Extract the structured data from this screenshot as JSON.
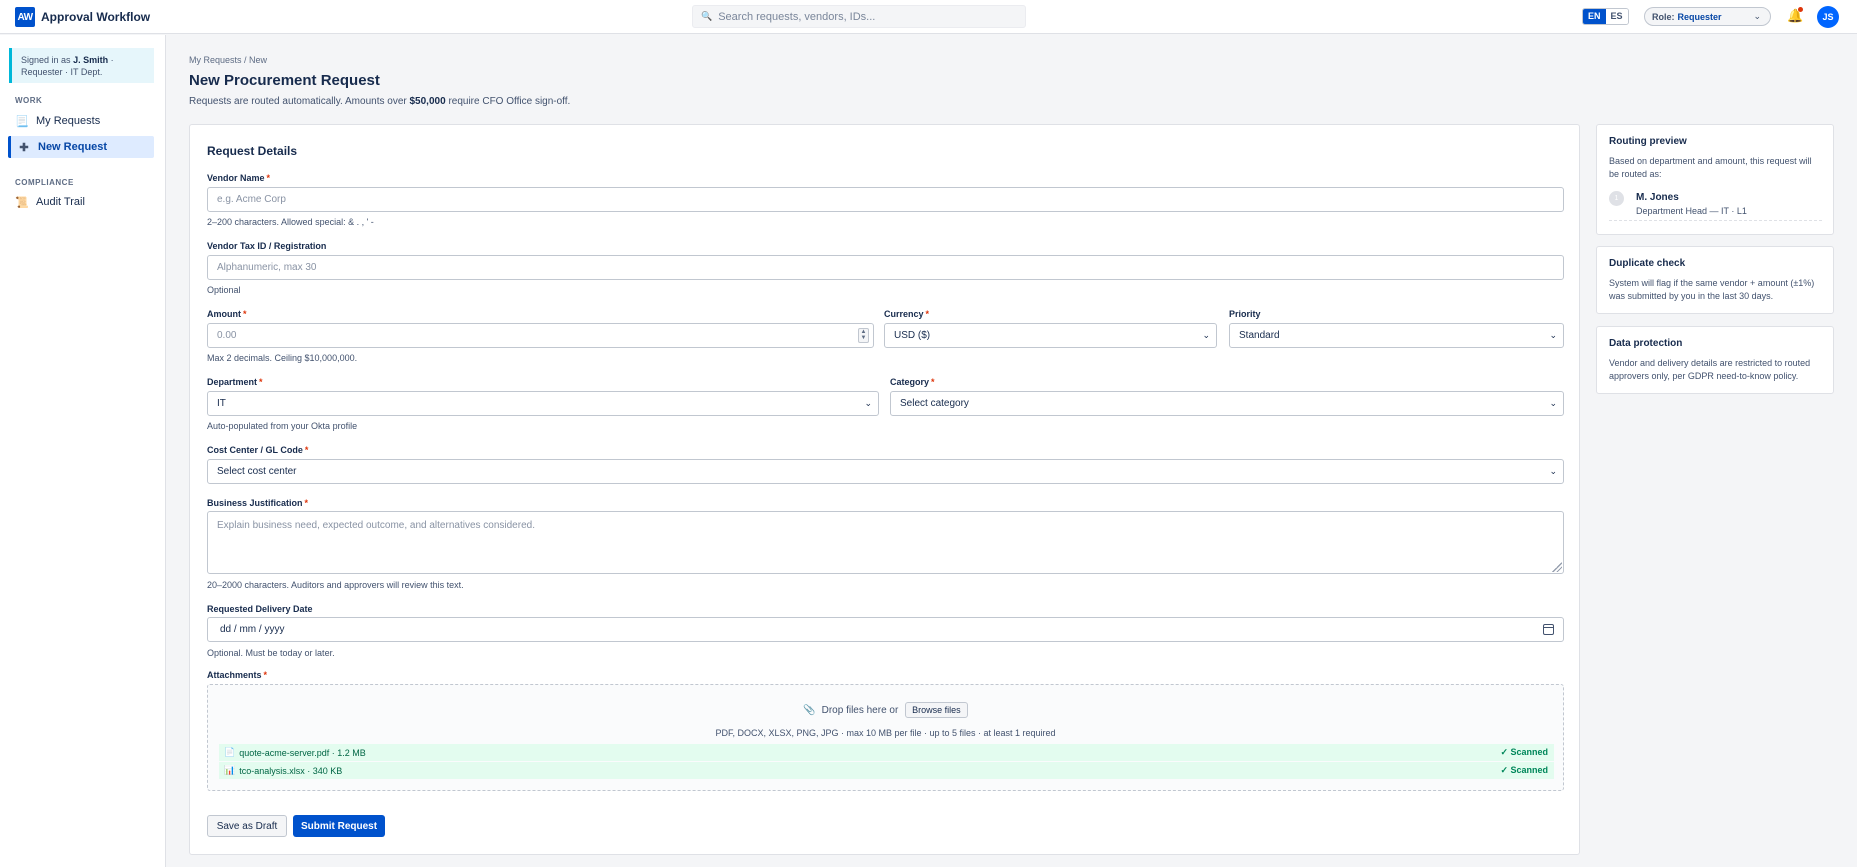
{
  "header": {
    "logo": "AW",
    "app_title": "Approval Workflow",
    "search_placeholder": "Search requests, vendors, IDs...",
    "languages": [
      "EN",
      "ES"
    ],
    "active_language": "EN",
    "role_label": "Role:",
    "role_value": "Requester",
    "avatar_initials": "JS"
  },
  "sidebar": {
    "signed_prefix": "Signed in as",
    "signed_name": "J. Smith",
    "signed_suffix": "·",
    "signed_role": "Requester · IT Dept.",
    "sections": [
      {
        "label": "WORK",
        "items": [
          {
            "label": "My Requests",
            "icon": "document-icon",
            "active": false
          },
          {
            "label": "New Request",
            "icon": "plus-icon",
            "active": true
          }
        ]
      },
      {
        "label": "COMPLIANCE",
        "items": [
          {
            "label": "Audit Trail",
            "icon": "scroll-icon",
            "active": false
          }
        ]
      }
    ]
  },
  "page": {
    "breadcrumb": "My Requests / New",
    "title": "New Procurement Request",
    "subtitle_pre": "Requests are routed automatically. Amounts over",
    "subtitle_amount": "$50,000",
    "subtitle_post": "require CFO Office sign-off."
  },
  "form": {
    "section_title": "Request Details",
    "vendor_name": {
      "label": "Vendor Name",
      "placeholder": "e.g. Acme Corp",
      "help": "2–200 characters. Allowed special: & . , ' -"
    },
    "vendor_tax": {
      "label": "Vendor Tax ID / Registration",
      "placeholder": "Alphanumeric, max 30",
      "help": "Optional"
    },
    "amount": {
      "label": "Amount",
      "placeholder": "0.00",
      "help": "Max 2 decimals. Ceiling $10,000,000."
    },
    "currency": {
      "label": "Currency",
      "value": "USD ($)"
    },
    "priority": {
      "label": "Priority",
      "value": "Standard"
    },
    "department": {
      "label": "Department",
      "value": "IT",
      "help": "Auto-populated from your Okta profile"
    },
    "category": {
      "label": "Category",
      "value": "Select category"
    },
    "cost_center": {
      "label": "Cost Center / GL Code",
      "value": "Select cost center"
    },
    "justification": {
      "label": "Business Justification",
      "placeholder": "Explain business need, expected outcome, and alternatives considered.",
      "help": "20–2000 characters. Auditors and approvers will review this text."
    },
    "delivery_date": {
      "label": "Requested Delivery Date",
      "value": "dd / mm / yyyy",
      "help": "Optional. Must be today or later."
    },
    "attachments": {
      "label": "Attachments",
      "drop_text": "Drop files here or",
      "browse_label": "Browse files",
      "rules": "PDF, DOCX, XLSX, PNG, JPG · max 10 MB per file · up to 5 files · at least 1 required",
      "files": [
        {
          "name": "quote-acme-server.pdf · 1.2 MB",
          "status": "✓ Scanned",
          "icon": "file-icon"
        },
        {
          "name": "tco-analysis.xlsx · 340 KB",
          "status": "✓ Scanned",
          "icon": "spreadsheet-icon"
        }
      ]
    },
    "save_draft_label": "Save as Draft",
    "submit_label": "Submit Request"
  },
  "panels": {
    "routing": {
      "title": "Routing preview",
      "text": "Based on department and amount, this request will be routed as:",
      "step": "1",
      "approver_name": "M. Jones",
      "approver_role": "Department Head — IT · L1"
    },
    "duplicate": {
      "title": "Duplicate check",
      "text": "System will flag if the same vendor + amount (±1%) was submitted by you in the last 30 days."
    },
    "protection": {
      "title": "Data protection",
      "text": "Vendor and delivery details are restricted to routed approvers only, per GDPR need-to-know policy."
    }
  },
  "colors": {
    "accent": "#0052cc",
    "required": "#de350b",
    "success": "#00875a"
  }
}
